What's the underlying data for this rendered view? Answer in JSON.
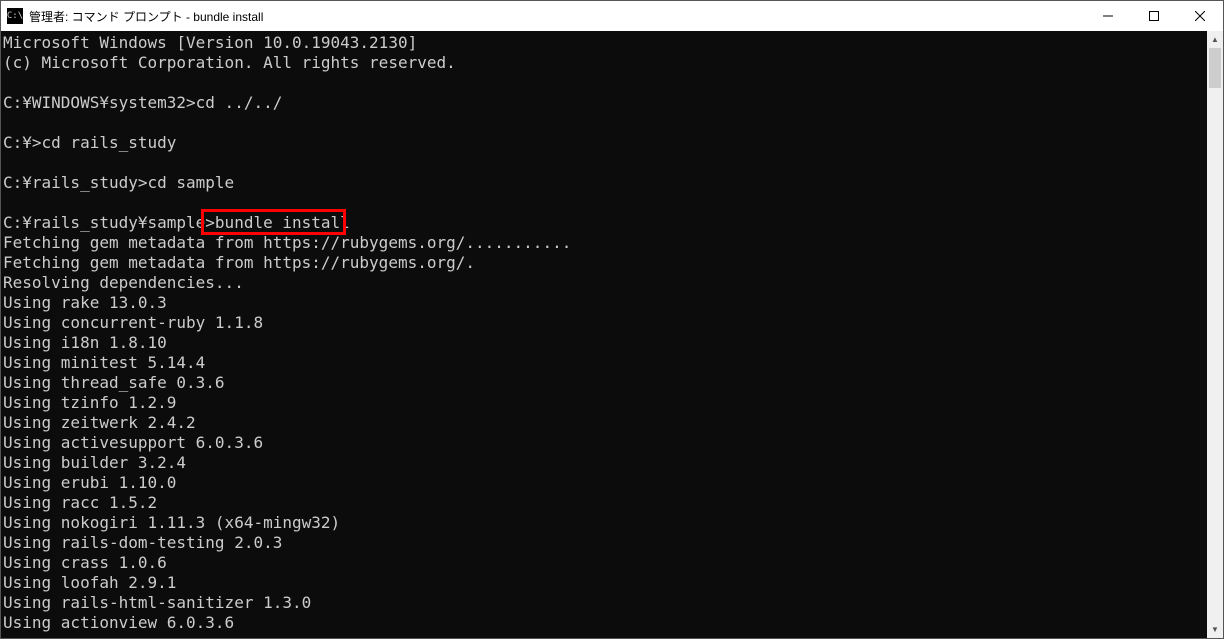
{
  "window": {
    "title": "管理者: コマンド プロンプト - bundle  install",
    "app_icon_text": "C:\\"
  },
  "terminal": {
    "lines": [
      "Microsoft Windows [Version 10.0.19043.2130]",
      "(c) Microsoft Corporation. All rights reserved.",
      "",
      "C:¥WINDOWS¥system32>cd ../../",
      "",
      "C:¥>cd rails_study",
      "",
      "C:¥rails_study>cd sample",
      "",
      "C:¥rails_study¥sample>bundle install",
      "Fetching gem metadata from https://rubygems.org/...........",
      "Fetching gem metadata from https://rubygems.org/.",
      "Resolving dependencies...",
      "Using rake 13.0.3",
      "Using concurrent-ruby 1.1.8",
      "Using i18n 1.8.10",
      "Using minitest 5.14.4",
      "Using thread_safe 0.3.6",
      "Using tzinfo 1.2.9",
      "Using zeitwerk 2.4.2",
      "Using activesupport 6.0.3.6",
      "Using builder 3.2.4",
      "Using erubi 1.10.0",
      "Using racc 1.5.2",
      "Using nokogiri 1.11.3 (x64-mingw32)",
      "Using rails-dom-testing 2.0.3",
      "Using crass 1.0.6",
      "Using loofah 2.9.1",
      "Using rails-html-sanitizer 1.3.0",
      "Using actionview 6.0.3.6"
    ]
  },
  "highlight": {
    "text": "bundle install",
    "line_index": 9,
    "char_start": 21,
    "char_end": 35
  }
}
